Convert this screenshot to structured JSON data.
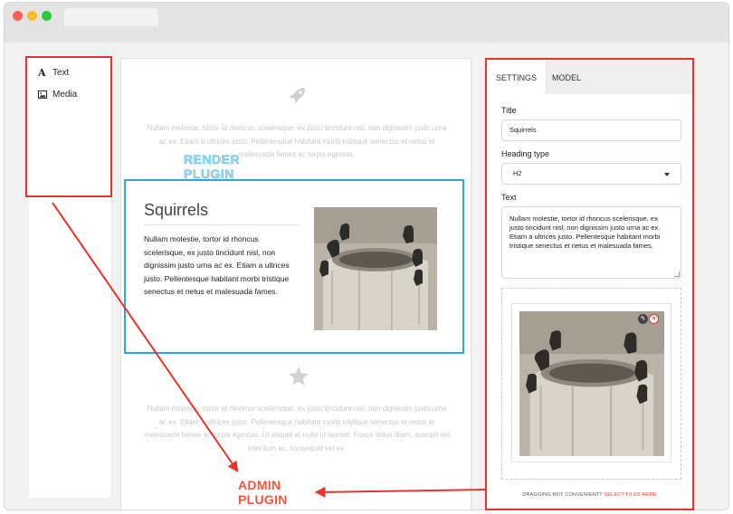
{
  "palette": {
    "items": [
      {
        "icon": "A",
        "label": "Text"
      },
      {
        "icon": "image-icon",
        "label": "Media"
      }
    ]
  },
  "canvas": {
    "ghost_top": "Nullam molestie, tortor id rhoncus scelerisque, ex justo tincidunt nisl, non dignissim justo urna ac ex. Etiam a ultrices justo. Pellentesque habitant morbi tristique senectus et netus et malesuada fames ac turpis egestas.",
    "ghost_bottom": "Nullam molestie, tortor id rhoncus scelerisque, ex justo tincidunt nisl, non dignissim justo urna ac ex. Etiam a ultrices justo. Pellentesque habitant morbi tristique senectus et netus et malesuada fames ac turpis egestas. Ut aliquet at nulla id laoreet. Fusce tellus diam, suscipit vel interdum ac, consequat vel ex.",
    "render": {
      "title": "Squirrels",
      "text": "Nullam molestie, tortor id rhoncus scelerisque, ex justo tincidunt nisl, non dignissim justo urna ac ex. Etiam a ultrices justo. Pellentesque habitant morbi tristique senectus et netus et malesuada fames."
    }
  },
  "annotations": {
    "render_label": "RENDER PLUGIN",
    "admin_label": "ADMIN PLUGIN"
  },
  "panel": {
    "tabs": [
      "SETTINGS",
      "MODEL"
    ],
    "title_label": "Title",
    "title_value": "Squirrels",
    "heading_label": "Heading type",
    "heading_value": "H2",
    "text_label": "Text",
    "text_value": "Nullam molestie, tortor id rhoncus scelerisque, ex justo tincidunt nisl, non dignissim justo urna ac ex. Etiam a ultrices justo. Pellentesque habitant morbi tristique senectus et netus et malesuada fames.",
    "drag_note": "DRAGGING NOT CONVENIENT?",
    "drag_link": "SELECT FILES HERE"
  },
  "colors": {
    "accent_red": "#e5352b",
    "render_blue": "#2fa3e6"
  }
}
